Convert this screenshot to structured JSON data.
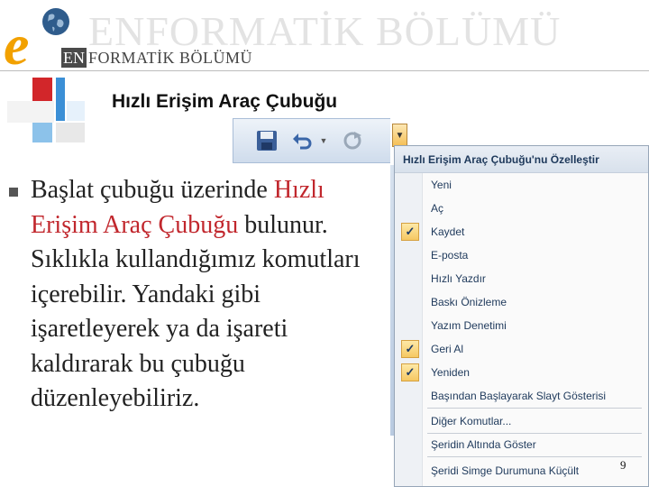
{
  "header": {
    "watermark": "ENFORMATİK BÖLÜMÜ",
    "logo_letter": "e",
    "brand_en": "EN",
    "brand_rest": "FORMATİK BÖLÜMÜ"
  },
  "slide": {
    "title": "Hızlı Erişim Araç Çubuğu",
    "body_1": "Başlat çubuğu üzerinde ",
    "body_highlight": "Hızlı Erişim Araç Çubuğu",
    "body_2": " bulunur. Sıklıkla kullandığımız komutları içerebilir. Yandaki gibi işaretleyerek ya da işareti kaldırarak bu çubuğu düzenleyebiliriz.",
    "page_number": "9"
  },
  "toolbar": {
    "icons": [
      "save-icon",
      "undo-icon",
      "undo-dropdown-icon",
      "redo-icon",
      "customize-dropdown-icon"
    ]
  },
  "menu": {
    "header": "Hızlı Erişim Araç Çubuğu'nu Özelleştir",
    "items": [
      {
        "label": "Yeni",
        "checked": false
      },
      {
        "label": "Aç",
        "checked": false
      },
      {
        "label": "Kaydet",
        "checked": true
      },
      {
        "label": "E-posta",
        "checked": false
      },
      {
        "label": "Hızlı Yazdır",
        "checked": false
      },
      {
        "label": "Baskı Önizleme",
        "checked": false
      },
      {
        "label": "Yazım Denetimi",
        "checked": false
      },
      {
        "label": "Geri Al",
        "checked": true
      },
      {
        "label": "Yeniden",
        "checked": true
      },
      {
        "label": "Başından Başlayarak Slayt Gösterisi",
        "checked": false
      },
      {
        "label": "Diğer Komutlar...",
        "checked": false
      },
      {
        "label": "Şeridin Altında Göster",
        "checked": false
      },
      {
        "label": "Şeridi Simge Durumuna Küçült",
        "checked": false
      }
    ],
    "check_glyph": "✓"
  },
  "colors": {
    "accent_orange": "#f2a100",
    "highlight_red": "#c1272d",
    "menu_text": "#1e395b"
  }
}
